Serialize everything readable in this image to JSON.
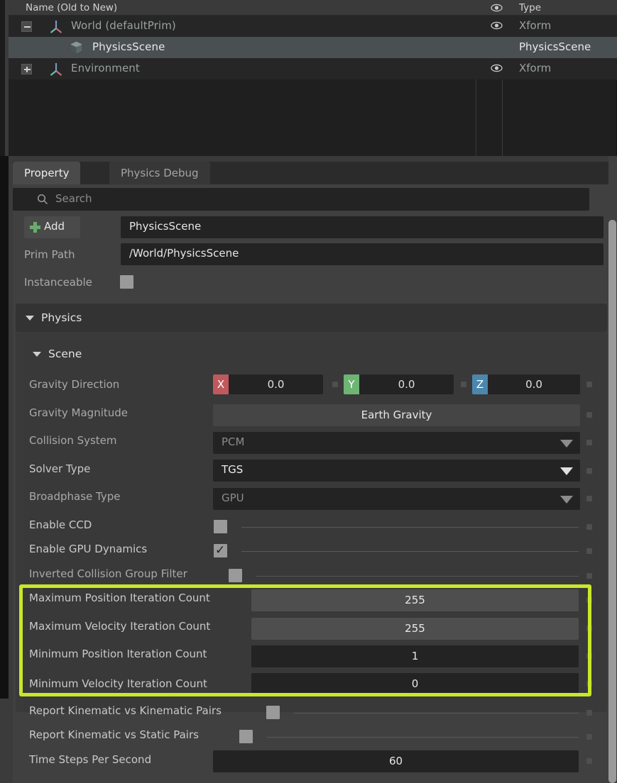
{
  "stage": {
    "columns": {
      "name": "Name (Old to New)",
      "visibility_icon": "eye-icon",
      "type": "Type"
    },
    "rows": [
      {
        "label": "World (defaultPrim)",
        "type": "Xform",
        "icon": "xform-axis-icon",
        "expander": "minus",
        "indent": 48,
        "selected": false,
        "visible": true
      },
      {
        "label": "PhysicsScene",
        "type": "PhysicsScene",
        "icon": "cube-icon",
        "expander": "none",
        "indent": 85,
        "selected": true,
        "visible": false
      },
      {
        "label": "Environment",
        "type": "Xform",
        "icon": "xform-axis-icon",
        "expander": "plus",
        "indent": 48,
        "selected": false,
        "visible": true
      }
    ]
  },
  "tabs": {
    "property": "Property",
    "physics_debug": "Physics Debug"
  },
  "search": {
    "placeholder": "Search",
    "value": "",
    "icon": "search-icon"
  },
  "header_fields": {
    "add_label": "Add",
    "prim_name_value": "PhysicsScene",
    "prim_path_label": "Prim Path",
    "prim_path_value": "/World/PhysicsScene",
    "instanceable_label": "Instanceable",
    "instanceable_checked": false
  },
  "groups": {
    "physics": "Physics",
    "scene": "Scene"
  },
  "properties": {
    "gravity_direction": {
      "label": "Gravity Direction",
      "axes": [
        {
          "name": "X",
          "value": "0.0",
          "color": "#c0595e"
        },
        {
          "name": "Y",
          "value": "0.0",
          "color": "#6eb473"
        },
        {
          "name": "Z",
          "value": "0.0",
          "color": "#4b87ad"
        }
      ]
    },
    "gravity_magnitude": {
      "label": "Gravity Magnitude",
      "value": "Earth Gravity"
    },
    "collision_system": {
      "label": "Collision System",
      "value": "PCM",
      "enabled": false
    },
    "solver_type": {
      "label": "Solver Type",
      "value": "TGS",
      "enabled": true
    },
    "broadphase_type": {
      "label": "Broadphase Type",
      "value": "GPU",
      "enabled": false
    },
    "enable_ccd": {
      "label": "Enable CCD",
      "checked": false
    },
    "enable_gpu_dynamics": {
      "label": "Enable GPU Dynamics",
      "checked": true
    },
    "inverted_collision_group_filter": {
      "label": "Inverted Collision Group Filter",
      "checked": false
    },
    "max_position_iteration_count": {
      "label": "Maximum Position Iteration Count",
      "value": "255"
    },
    "max_velocity_iteration_count": {
      "label": "Maximum Velocity Iteration Count",
      "value": "255"
    },
    "min_position_iteration_count": {
      "label": "Minimum Position Iteration Count",
      "value": "1"
    },
    "min_velocity_iteration_count": {
      "label": "Minimum Velocity Iteration Count",
      "value": "0"
    },
    "report_kinematic_vs_kinematic": {
      "label": "Report Kinematic vs Kinematic Pairs",
      "checked": false
    },
    "report_kinematic_vs_static": {
      "label": "Report Kinematic vs Static Pairs",
      "checked": false
    },
    "time_steps_per_second": {
      "label": "Time Steps Per Second",
      "value": "60"
    }
  },
  "annotation": {
    "highlight_color": "#c9e72b"
  }
}
